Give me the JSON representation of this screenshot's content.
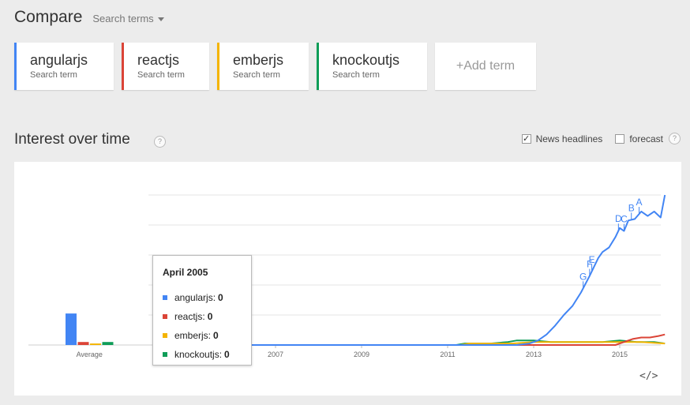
{
  "header": {
    "title": "Compare",
    "dropdown_label": "Search terms"
  },
  "terms": [
    {
      "name": "angularjs",
      "sub": "Search term",
      "color": "#4285f4"
    },
    {
      "name": "reactjs",
      "sub": "Search term",
      "color": "#db4437"
    },
    {
      "name": "emberjs",
      "sub": "Search term",
      "color": "#f4b400"
    },
    {
      "name": "knockoutjs",
      "sub": "Search term",
      "color": "#0f9d58"
    }
  ],
  "add_term_label": "+Add term",
  "section": {
    "title": "Interest over time",
    "help": "?"
  },
  "options": {
    "news_label": "News headlines",
    "news_checked": true,
    "forecast_label": "forecast",
    "forecast_checked": false,
    "forecast_help": "?"
  },
  "tooltip": {
    "title": "April 2005",
    "rows": [
      {
        "label": "angularjs:",
        "value": "0",
        "color": "#4285f4"
      },
      {
        "label": "reactjs:",
        "value": "0",
        "color": "#db4437"
      },
      {
        "label": "emberjs:",
        "value": "0",
        "color": "#f4b400"
      },
      {
        "label": "knockoutjs:",
        "value": "0",
        "color": "#0f9d58"
      }
    ]
  },
  "embed_label": "</>",
  "chart_data": {
    "type": "line",
    "x_ticks": [
      "2007",
      "2009",
      "2011",
      "2013",
      "2015"
    ],
    "ylim": [
      0,
      100
    ],
    "grid": true,
    "average": {
      "label": "Average",
      "values": [
        {
          "series": "angularjs",
          "value": 21
        },
        {
          "series": "reactjs",
          "value": 2
        },
        {
          "series": "emberjs",
          "value": 1
        },
        {
          "series": "knockoutjs",
          "value": 2
        }
      ]
    },
    "series": [
      {
        "name": "angularjs",
        "color": "#4285f4",
        "points": [
          [
            2005.3,
            0
          ],
          [
            2012.6,
            0
          ],
          [
            2012.9,
            1
          ],
          [
            2013.1,
            3
          ],
          [
            2013.3,
            7
          ],
          [
            2013.5,
            13
          ],
          [
            2013.7,
            20
          ],
          [
            2013.9,
            26
          ],
          [
            2014.1,
            35
          ],
          [
            2014.3,
            46
          ],
          [
            2014.5,
            58
          ],
          [
            2014.6,
            62
          ],
          [
            2014.75,
            65
          ],
          [
            2014.9,
            72
          ],
          [
            2015.0,
            78
          ],
          [
            2015.1,
            76
          ],
          [
            2015.2,
            83
          ],
          [
            2015.35,
            84
          ],
          [
            2015.5,
            89
          ],
          [
            2015.65,
            86
          ],
          [
            2015.8,
            89
          ],
          [
            2015.95,
            85
          ],
          [
            2016.05,
            100
          ]
        ]
      },
      {
        "name": "reactjs",
        "color": "#db4437",
        "points": [
          [
            2005.3,
            0
          ],
          [
            2014.9,
            0
          ],
          [
            2015.1,
            2
          ],
          [
            2015.3,
            4
          ],
          [
            2015.5,
            5
          ],
          [
            2015.7,
            5
          ],
          [
            2015.9,
            6
          ],
          [
            2016.05,
            7
          ]
        ]
      },
      {
        "name": "emberjs",
        "color": "#f4b400",
        "points": [
          [
            2005.3,
            0
          ],
          [
            2011.3,
            0
          ],
          [
            2011.5,
            1
          ],
          [
            2012.0,
            1
          ],
          [
            2012.5,
            1
          ],
          [
            2013.0,
            2
          ],
          [
            2013.5,
            2
          ],
          [
            2014.0,
            2
          ],
          [
            2014.5,
            2
          ],
          [
            2015.0,
            2
          ],
          [
            2015.5,
            2
          ],
          [
            2016.05,
            1
          ]
        ]
      },
      {
        "name": "knockoutjs",
        "color": "#0f9d58",
        "points": [
          [
            2005.3,
            0
          ],
          [
            2011.2,
            0
          ],
          [
            2011.4,
            1
          ],
          [
            2012.0,
            1
          ],
          [
            2012.4,
            2
          ],
          [
            2012.6,
            3
          ],
          [
            2013.0,
            3
          ],
          [
            2013.4,
            2
          ],
          [
            2013.8,
            2
          ],
          [
            2014.2,
            2
          ],
          [
            2014.6,
            2
          ],
          [
            2015.0,
            3
          ],
          [
            2015.4,
            2
          ],
          [
            2015.8,
            2
          ],
          [
            2016.05,
            1
          ]
        ]
      }
    ],
    "annotations": [
      {
        "label": "G",
        "x": 2014.15
      },
      {
        "label": "F",
        "x": 2014.3
      },
      {
        "label": "E",
        "x": 2014.35
      },
      {
        "label": "D",
        "x": 2014.97
      },
      {
        "label": "C",
        "x": 2015.1
      },
      {
        "label": "B",
        "x": 2015.27
      },
      {
        "label": "A",
        "x": 2015.45
      }
    ]
  }
}
